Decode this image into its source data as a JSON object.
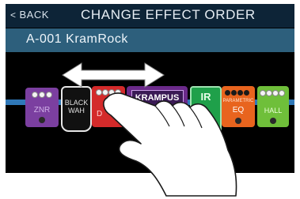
{
  "header": {
    "back_label": "BACK",
    "title": "CHANGE EFFECT ORDER"
  },
  "patch": {
    "name": "A-001 KramRock"
  },
  "effects": {
    "znr": {
      "label": "ZNR",
      "color": "#7b3fa0"
    },
    "blackwah": {
      "label_line1": "BLACK",
      "label_line2": "WAH",
      "color": "#1a1a1a"
    },
    "drive": {
      "label": "D",
      "color": "#d42a2a"
    },
    "krampus": {
      "label": "KRAMPUS",
      "color": "#6b2a8a"
    },
    "ir": {
      "label": "IR",
      "color": "#1fa04a"
    },
    "eq": {
      "label_small": "PARAMETRIC",
      "label": "EQ",
      "color": "#e8641e"
    },
    "hall": {
      "label": "HALL",
      "color": "#6fbf3a"
    }
  },
  "gesture": {
    "icon": "hand-pointer-icon",
    "arrow": "double-arrow-icon"
  }
}
